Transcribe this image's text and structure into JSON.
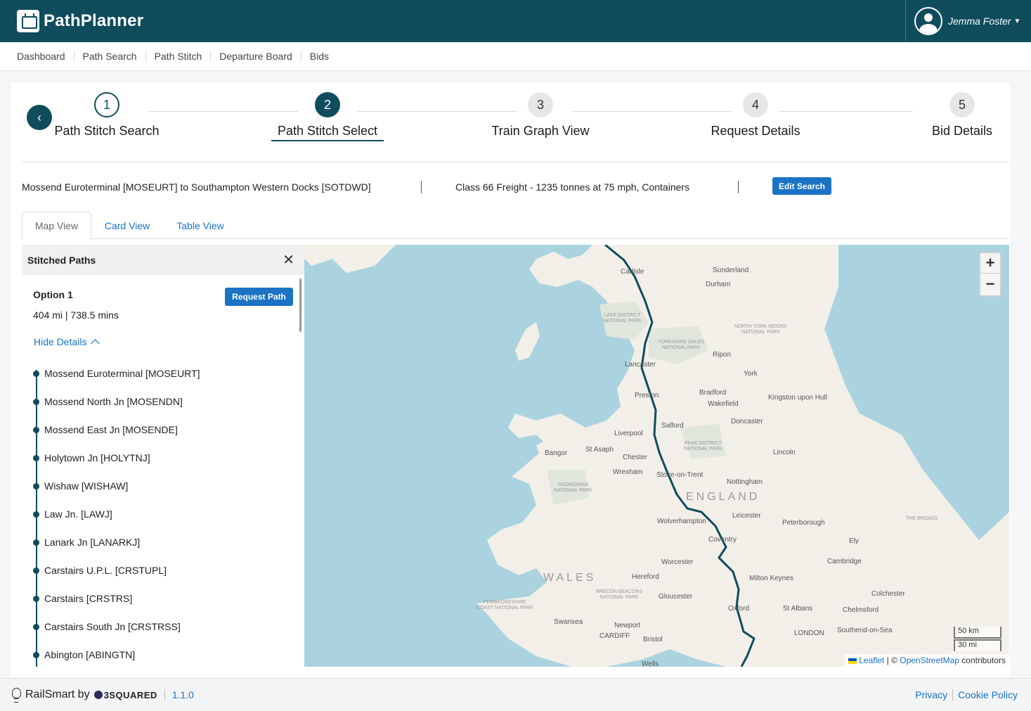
{
  "app": {
    "title": "PathPlanner"
  },
  "user": {
    "name": "Jemma Foster"
  },
  "nav": [
    "Dashboard",
    "Path Search",
    "Path Stitch",
    "Departure Board",
    "Bids"
  ],
  "steps": [
    {
      "number": "1",
      "label": "Path Stitch Search",
      "state": "done"
    },
    {
      "number": "2",
      "label": "Path Stitch Select",
      "state": "active"
    },
    {
      "number": "3",
      "label": "Train Graph View",
      "state": "todo"
    },
    {
      "number": "4",
      "label": "Request Details",
      "state": "todo"
    },
    {
      "number": "5",
      "label": "Bid Details",
      "state": "todo"
    }
  ],
  "summary": {
    "route": "Mossend Euroterminal [MOSEURT] to Southampton Western Docks [SOTDWD]",
    "train": "Class 66 Freight - 1235 tonnes at 75 mph, Containers",
    "edit_label": "Edit Search"
  },
  "tabs": [
    "Map View",
    "Card View",
    "Table View"
  ],
  "panel": {
    "title": "Stitched Paths",
    "option_title": "Option 1",
    "option_meta": "404 mi | 738.5 mins",
    "request_label": "Request Path",
    "hide_details": "Hide Details",
    "stops": [
      "Mossend Euroterminal [MOSEURT]",
      "Mossend North Jn [MOSENDN]",
      "Mossend East Jn [MOSENDE]",
      "Holytown Jn [HOLYTNJ]",
      "Wishaw [WISHAW]",
      "Law Jn. [LAWJ]",
      "Lanark Jn [LANARKJ]",
      "Carstairs U.P.L. [CRSTUPL]",
      "Carstairs [CRSTRS]",
      "Carstairs South Jn [CRSTRSS]",
      "Abington [ABINGTN]"
    ]
  },
  "map": {
    "zoom_in": "+",
    "zoom_out": "−",
    "scale_km": "50 km",
    "scale_mi": "30 mi",
    "attribution_leaflet": "Leaflet",
    "attribution_sep": "| ©",
    "attribution_osm": "OpenStreetMap",
    "attribution_contrib": "contributors",
    "route_color": "#0f4c5c",
    "places": {
      "carlisle": "Carlisle",
      "sunderland": "Sunderland",
      "durham": "Durham",
      "lake": "LAKE DISTRICT\nNATIONAL PARK",
      "nym": "NORTH YORK MOORS\nNATIONAL PARK",
      "ydales": "YORKSHIRE DALES\nNATIONAL PARK",
      "ripon": "Ripon",
      "york": "York",
      "lancaster": "Lancaster",
      "bradford": "Bradford",
      "wakefield": "Wakefield",
      "hull": "Kingston upon Hull",
      "preston": "Preston",
      "doncaster": "Doncaster",
      "salford": "Salford",
      "liverpool": "Liverpool",
      "peak": "PEAK DISTRICT\nNATIONAL PARK",
      "bangor": "Bangor",
      "stasaph": "St Asaph",
      "chester": "Chester",
      "lincoln": "Lincoln",
      "wrexham": "Wrexham",
      "stoke": "Stoke-on-Trent",
      "snowdonia": "SNOWDONIA\nNATIONAL PARK",
      "nottingham": "Nottingham",
      "england": "ENGLAND",
      "leicester": "Leicester",
      "wolverhampton": "Wolverhampton",
      "peterborough": "Peterborough",
      "broads": "THE BROADS",
      "coventry": "Coventry",
      "ely": "Ely",
      "worcester": "Worcester",
      "cambridge": "Cambridge",
      "wales": "WALES",
      "hereford": "Hereford",
      "miltonkeynes": "Milton Keynes",
      "breconbeacons": "BRECON BEACONS\nNATIONAL PARK",
      "gloucester": "Gloucester",
      "colchester": "Colchester",
      "pembroke": "PEMBROKESHIRE\nCOAST NATIONAL PARK",
      "oxford": "Oxford",
      "stalbans": "St Albans",
      "chelmsford": "Chelmsford",
      "swansea": "Swansea",
      "newport": "Newport",
      "southend": "Southend-on-Sea",
      "cardiff": "CARDIFF",
      "bristol": "Bristol",
      "london": "LONDON",
      "wells": "Wells"
    }
  },
  "footer": {
    "brand": "RailSmart by",
    "company": "3SQUARED",
    "version": "1.1.0",
    "privacy": "Privacy",
    "cookie": "Cookie Policy"
  }
}
